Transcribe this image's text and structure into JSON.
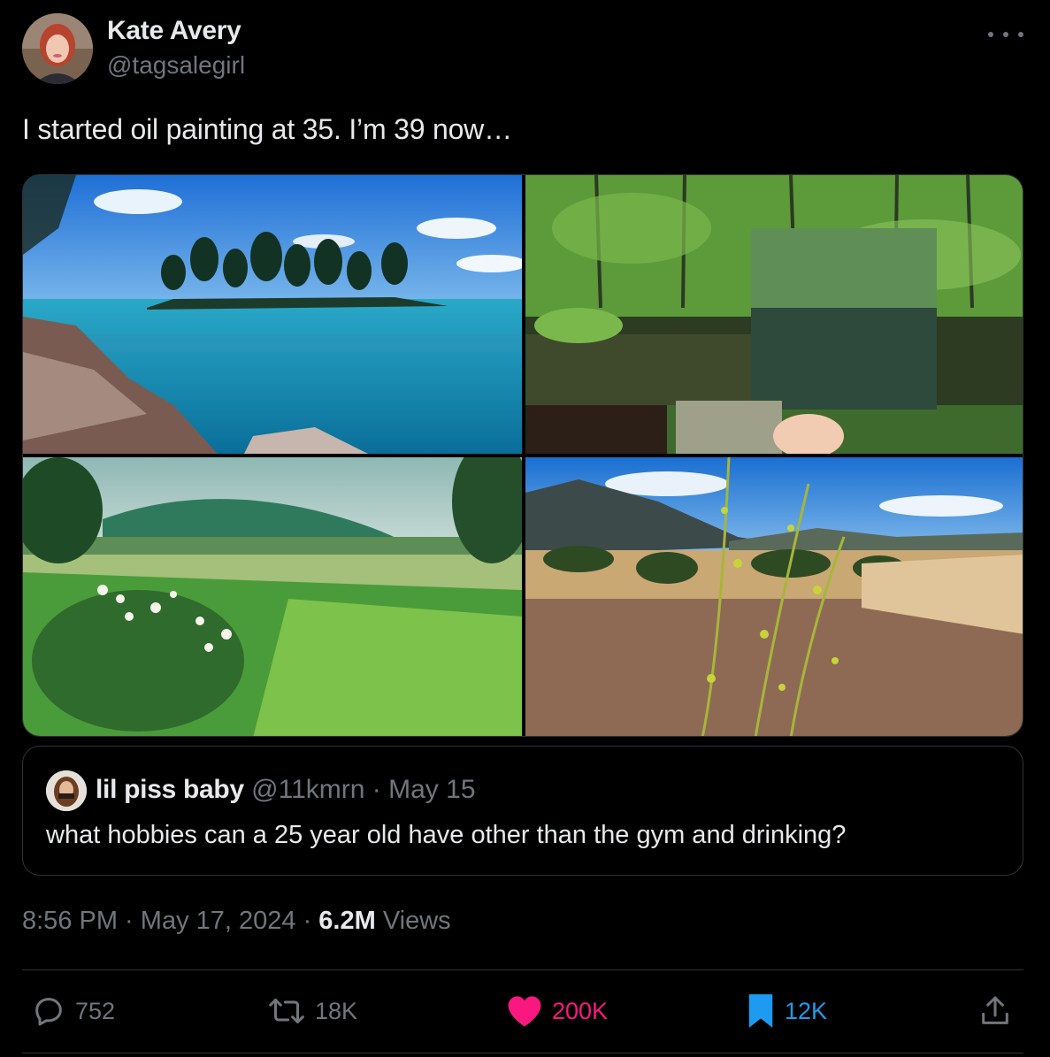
{
  "author": {
    "name": "Kate Avery",
    "handle": "@tagsalegirl"
  },
  "tweet": {
    "text": "I started oil painting at 35. I’m 39 now…"
  },
  "quoted_tweet": {
    "name": "lil piss baby",
    "handle": "@11kmrn",
    "separator": "·",
    "date": "May 15",
    "text": "what hobbies can a 25 year old have other than the gym and drinking?"
  },
  "meta": {
    "time": "8:56 PM",
    "sep1": " · ",
    "date": "May 17, 2024",
    "sep2": " · ",
    "views_count": "6.2M",
    "views_label": " Views"
  },
  "actions": {
    "reply_count": "752",
    "retweet_count": "18K",
    "like_count": "200K",
    "bookmark_count": "12K"
  },
  "icons": {
    "more": "more-horizontal-icon",
    "reply": "reply-icon",
    "retweet": "retweet-icon",
    "like": "heart-filled-icon",
    "bookmark": "bookmark-filled-icon",
    "share": "share-icon"
  },
  "colors": {
    "background": "#000000",
    "text_primary": "#e7e9ea",
    "text_secondary": "#71767b",
    "border": "#2f3336",
    "like": "#f91880",
    "bookmark": "#1d9bf0"
  }
}
